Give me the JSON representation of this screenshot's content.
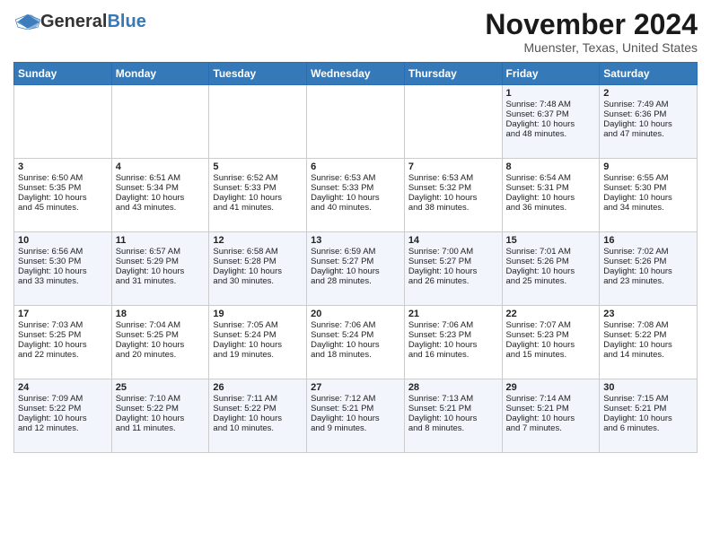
{
  "header": {
    "logo_general": "General",
    "logo_blue": "Blue",
    "month": "November 2024",
    "location": "Muenster, Texas, United States"
  },
  "days_of_week": [
    "Sunday",
    "Monday",
    "Tuesday",
    "Wednesday",
    "Thursday",
    "Friday",
    "Saturday"
  ],
  "weeks": [
    [
      {
        "day": "",
        "info": ""
      },
      {
        "day": "",
        "info": ""
      },
      {
        "day": "",
        "info": ""
      },
      {
        "day": "",
        "info": ""
      },
      {
        "day": "",
        "info": ""
      },
      {
        "day": "1",
        "info": "Sunrise: 7:48 AM\nSunset: 6:37 PM\nDaylight: 10 hours\nand 48 minutes."
      },
      {
        "day": "2",
        "info": "Sunrise: 7:49 AM\nSunset: 6:36 PM\nDaylight: 10 hours\nand 47 minutes."
      }
    ],
    [
      {
        "day": "3",
        "info": "Sunrise: 6:50 AM\nSunset: 5:35 PM\nDaylight: 10 hours\nand 45 minutes."
      },
      {
        "day": "4",
        "info": "Sunrise: 6:51 AM\nSunset: 5:34 PM\nDaylight: 10 hours\nand 43 minutes."
      },
      {
        "day": "5",
        "info": "Sunrise: 6:52 AM\nSunset: 5:33 PM\nDaylight: 10 hours\nand 41 minutes."
      },
      {
        "day": "6",
        "info": "Sunrise: 6:53 AM\nSunset: 5:33 PM\nDaylight: 10 hours\nand 40 minutes."
      },
      {
        "day": "7",
        "info": "Sunrise: 6:53 AM\nSunset: 5:32 PM\nDaylight: 10 hours\nand 38 minutes."
      },
      {
        "day": "8",
        "info": "Sunrise: 6:54 AM\nSunset: 5:31 PM\nDaylight: 10 hours\nand 36 minutes."
      },
      {
        "day": "9",
        "info": "Sunrise: 6:55 AM\nSunset: 5:30 PM\nDaylight: 10 hours\nand 34 minutes."
      }
    ],
    [
      {
        "day": "10",
        "info": "Sunrise: 6:56 AM\nSunset: 5:30 PM\nDaylight: 10 hours\nand 33 minutes."
      },
      {
        "day": "11",
        "info": "Sunrise: 6:57 AM\nSunset: 5:29 PM\nDaylight: 10 hours\nand 31 minutes."
      },
      {
        "day": "12",
        "info": "Sunrise: 6:58 AM\nSunset: 5:28 PM\nDaylight: 10 hours\nand 30 minutes."
      },
      {
        "day": "13",
        "info": "Sunrise: 6:59 AM\nSunset: 5:27 PM\nDaylight: 10 hours\nand 28 minutes."
      },
      {
        "day": "14",
        "info": "Sunrise: 7:00 AM\nSunset: 5:27 PM\nDaylight: 10 hours\nand 26 minutes."
      },
      {
        "day": "15",
        "info": "Sunrise: 7:01 AM\nSunset: 5:26 PM\nDaylight: 10 hours\nand 25 minutes."
      },
      {
        "day": "16",
        "info": "Sunrise: 7:02 AM\nSunset: 5:26 PM\nDaylight: 10 hours\nand 23 minutes."
      }
    ],
    [
      {
        "day": "17",
        "info": "Sunrise: 7:03 AM\nSunset: 5:25 PM\nDaylight: 10 hours\nand 22 minutes."
      },
      {
        "day": "18",
        "info": "Sunrise: 7:04 AM\nSunset: 5:25 PM\nDaylight: 10 hours\nand 20 minutes."
      },
      {
        "day": "19",
        "info": "Sunrise: 7:05 AM\nSunset: 5:24 PM\nDaylight: 10 hours\nand 19 minutes."
      },
      {
        "day": "20",
        "info": "Sunrise: 7:06 AM\nSunset: 5:24 PM\nDaylight: 10 hours\nand 18 minutes."
      },
      {
        "day": "21",
        "info": "Sunrise: 7:06 AM\nSunset: 5:23 PM\nDaylight: 10 hours\nand 16 minutes."
      },
      {
        "day": "22",
        "info": "Sunrise: 7:07 AM\nSunset: 5:23 PM\nDaylight: 10 hours\nand 15 minutes."
      },
      {
        "day": "23",
        "info": "Sunrise: 7:08 AM\nSunset: 5:22 PM\nDaylight: 10 hours\nand 14 minutes."
      }
    ],
    [
      {
        "day": "24",
        "info": "Sunrise: 7:09 AM\nSunset: 5:22 PM\nDaylight: 10 hours\nand 12 minutes."
      },
      {
        "day": "25",
        "info": "Sunrise: 7:10 AM\nSunset: 5:22 PM\nDaylight: 10 hours\nand 11 minutes."
      },
      {
        "day": "26",
        "info": "Sunrise: 7:11 AM\nSunset: 5:22 PM\nDaylight: 10 hours\nand 10 minutes."
      },
      {
        "day": "27",
        "info": "Sunrise: 7:12 AM\nSunset: 5:21 PM\nDaylight: 10 hours\nand 9 minutes."
      },
      {
        "day": "28",
        "info": "Sunrise: 7:13 AM\nSunset: 5:21 PM\nDaylight: 10 hours\nand 8 minutes."
      },
      {
        "day": "29",
        "info": "Sunrise: 7:14 AM\nSunset: 5:21 PM\nDaylight: 10 hours\nand 7 minutes."
      },
      {
        "day": "30",
        "info": "Sunrise: 7:15 AM\nSunset: 5:21 PM\nDaylight: 10 hours\nand 6 minutes."
      }
    ]
  ]
}
